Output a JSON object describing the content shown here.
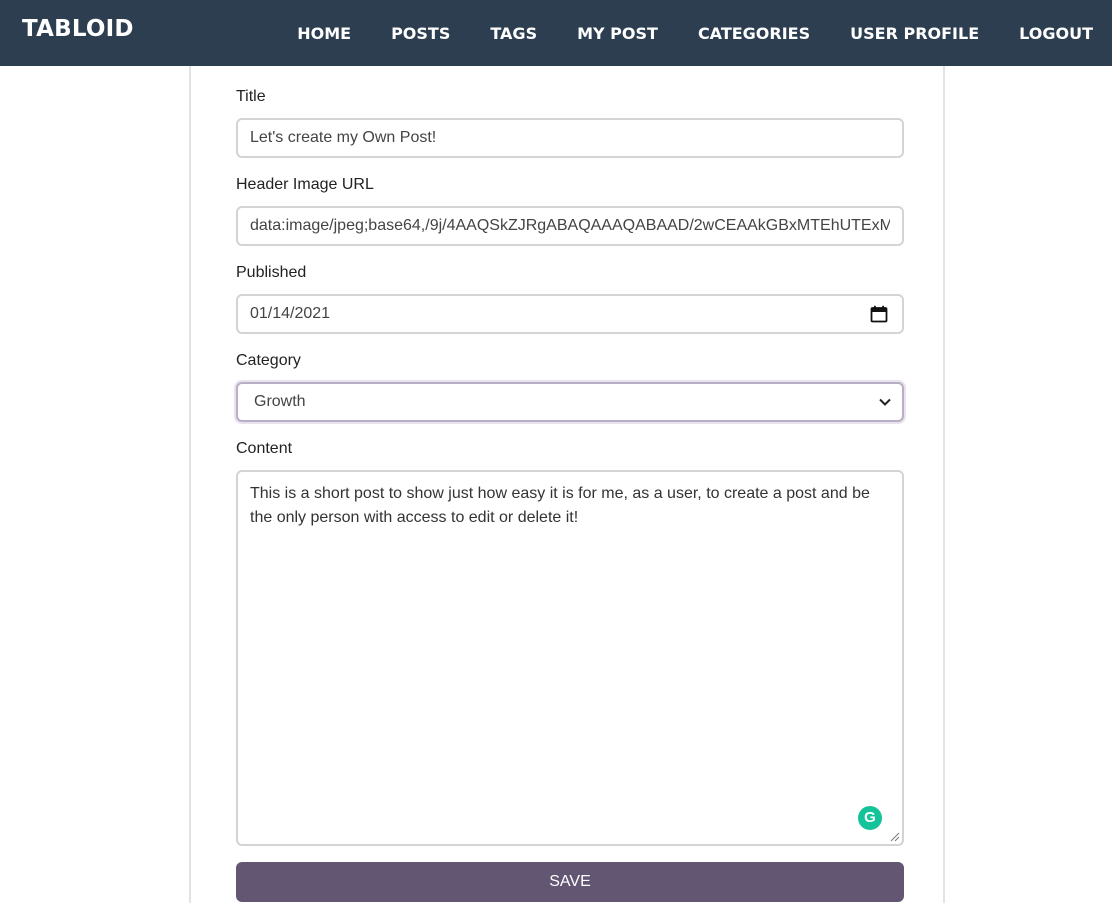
{
  "navbar": {
    "brand": "TABLOID",
    "links": [
      "HOME",
      "POSTS",
      "TAGS",
      "MY POST",
      "CATEGORIES",
      "USER PROFILE",
      "LOGOUT"
    ],
    "background_color": "#2c3e50"
  },
  "form": {
    "title": {
      "label": "Title",
      "value": "Let's create my Own Post!"
    },
    "header_image": {
      "label": "Header Image URL",
      "value": "data:image/jpeg;base64,/9j/4AAQSkZJRgABAQAAAQABAAD/2wCEAAkGBxMTEhUTExM"
    },
    "published": {
      "label": "Published",
      "value": "01/14/2021",
      "icon": "calendar-icon"
    },
    "category": {
      "label": "Category",
      "selected": "Growth",
      "icon": "chevron-down-icon"
    },
    "content": {
      "label": "Content",
      "value": "This is a short post to show just how easy it is for me, as a user, to create a post and be the only person with access to edit or delete it!"
    },
    "save_label": "SAVE",
    "save_color": "#625673"
  },
  "grammarly": {
    "glyph": "G",
    "color": "#15c39a"
  }
}
